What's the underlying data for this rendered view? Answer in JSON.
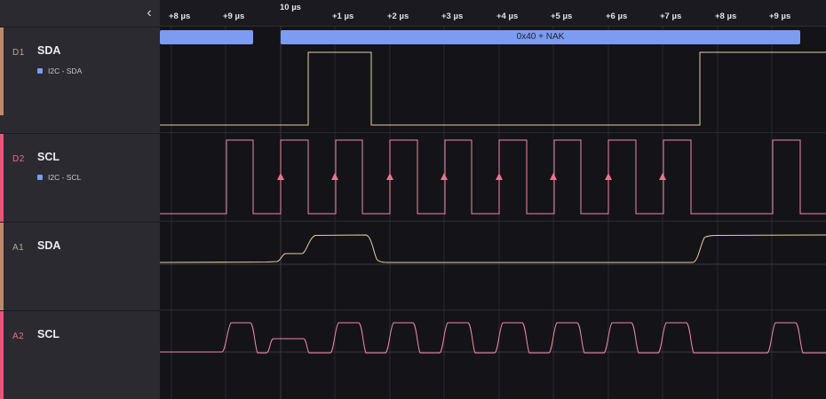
{
  "sidebar": {
    "collapse_glyph": "‹",
    "channels": [
      {
        "id": "D1",
        "name": "SDA",
        "analyzer": "I2C - SDA",
        "color": "#c0886a",
        "id_color": "#b7a79a"
      },
      {
        "id": "D2",
        "name": "SCL",
        "analyzer": "I2C - SCL",
        "color": "#e8557a",
        "id_color": "#e66c86"
      },
      {
        "id": "A1",
        "name": "SDA",
        "color": "#c0886a",
        "id_color": "#b7a79a"
      },
      {
        "id": "A2",
        "name": "SCL",
        "color": "#e8557a",
        "id_color": "#e66c86"
      }
    ]
  },
  "timeline": {
    "ticks": [
      "+8 µs",
      "+9 µs",
      "10 µs",
      "+1 µs",
      "+2 µs",
      "+3 µs",
      "+4 µs",
      "+5 µs",
      "+6 µs",
      "+7 µs",
      "+8 µs",
      "+9 µs"
    ]
  },
  "decoder": {
    "frame_label": "0x40 + NAK"
  },
  "colors": {
    "sda_trace": "#e9cfa0",
    "scl_trace": "#f08aa6",
    "bubble": "#7b9cf0",
    "grid": "#2a2930",
    "background": "#141318"
  },
  "icons": {
    "collapse": "chevron-left-icon",
    "rising_edge": "triangle-up-icon",
    "analyzer": "square-icon"
  }
}
